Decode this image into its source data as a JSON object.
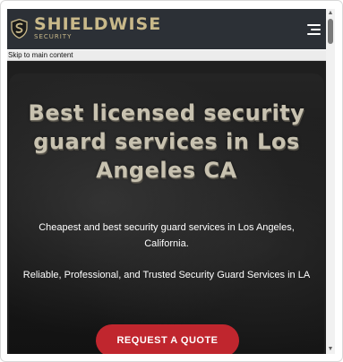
{
  "header": {
    "logo_word": "SHIELDWISE",
    "logo_sub": "SECURITY"
  },
  "skip_link": "Skip to main content",
  "hero": {
    "title": "Best licensed security guard services in Los Angeles CA",
    "subtitle_1": "Cheapest and best security guard services in Los Angeles, California.",
    "subtitle_2": "Reliable, Professional, and Trusted Security Guard Services in LA",
    "cta_label": "REQUEST A QUOTE"
  },
  "icons": {
    "logo": "shield-logo-icon",
    "menu": "hamburger-menu-icon",
    "scroll_up": "scroll-up-arrow-icon",
    "scroll_down": "scroll-down-arrow-icon"
  },
  "colors": {
    "header_bg": "#2c3036",
    "brand_gold": "#c9b98a",
    "cta_red": "#c0262e"
  }
}
